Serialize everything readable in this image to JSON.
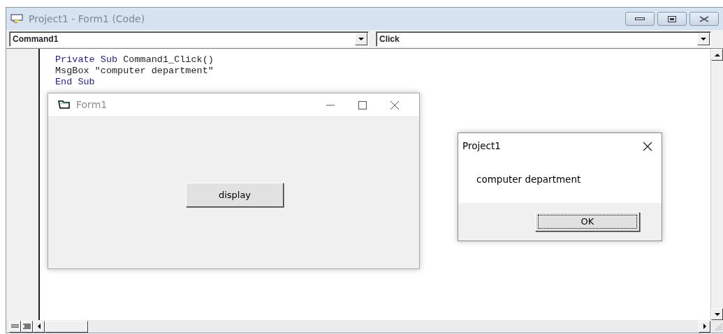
{
  "window": {
    "title": "Project1 - Form1 (Code)"
  },
  "object_dropdown": {
    "value": "Command1"
  },
  "procedure_dropdown": {
    "value": "Click"
  },
  "code_lines": [
    {
      "tokens": [
        {
          "text": "Private Sub",
          "kind": "keyword"
        },
        {
          "text": " Command1_Click()",
          "kind": "plain"
        }
      ]
    },
    {
      "tokens": [
        {
          "text": "MsgBox \"computer department\"",
          "kind": "plain"
        }
      ]
    },
    {
      "tokens": [
        {
          "text": "End Sub",
          "kind": "keyword"
        }
      ]
    }
  ],
  "form_window": {
    "title": "Form1",
    "button": "display"
  },
  "message_box": {
    "title": "Project1",
    "message": "computer department",
    "button": "OK"
  }
}
